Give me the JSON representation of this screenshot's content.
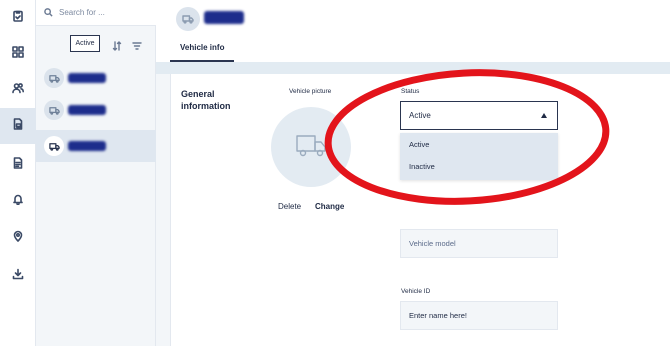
{
  "icons": {
    "rail": [
      "clipboard-check-icon",
      "dashboard-grid-icon",
      "users-icon",
      "vehicle-document-icon",
      "document-icon",
      "bell-icon",
      "location-pin-icon",
      "download-icon"
    ],
    "search": "search-icon",
    "sort": "sort-icon",
    "filter": "filter-icon",
    "truck": "truck-icon"
  },
  "colors": {
    "accent": "#2a3550",
    "annotation": "#e3141b",
    "selected_bg": "#dfe7f0"
  },
  "list": {
    "search_placeholder": "Search for ...",
    "filter_chip": "Active"
  },
  "main": {
    "tab_label": "Vehicle info",
    "section_title": "General information",
    "picture_label": "Vehicle picture",
    "delete_label": "Delete",
    "change_label": "Change",
    "status": {
      "label": "Status",
      "selected": "Active",
      "options": [
        "Active",
        "Inactive"
      ]
    },
    "vehicle_model_placeholder": "Vehicle model",
    "vehicle_id_label": "Vehicle ID",
    "vehicle_id_placeholder": "Enter name here!"
  }
}
